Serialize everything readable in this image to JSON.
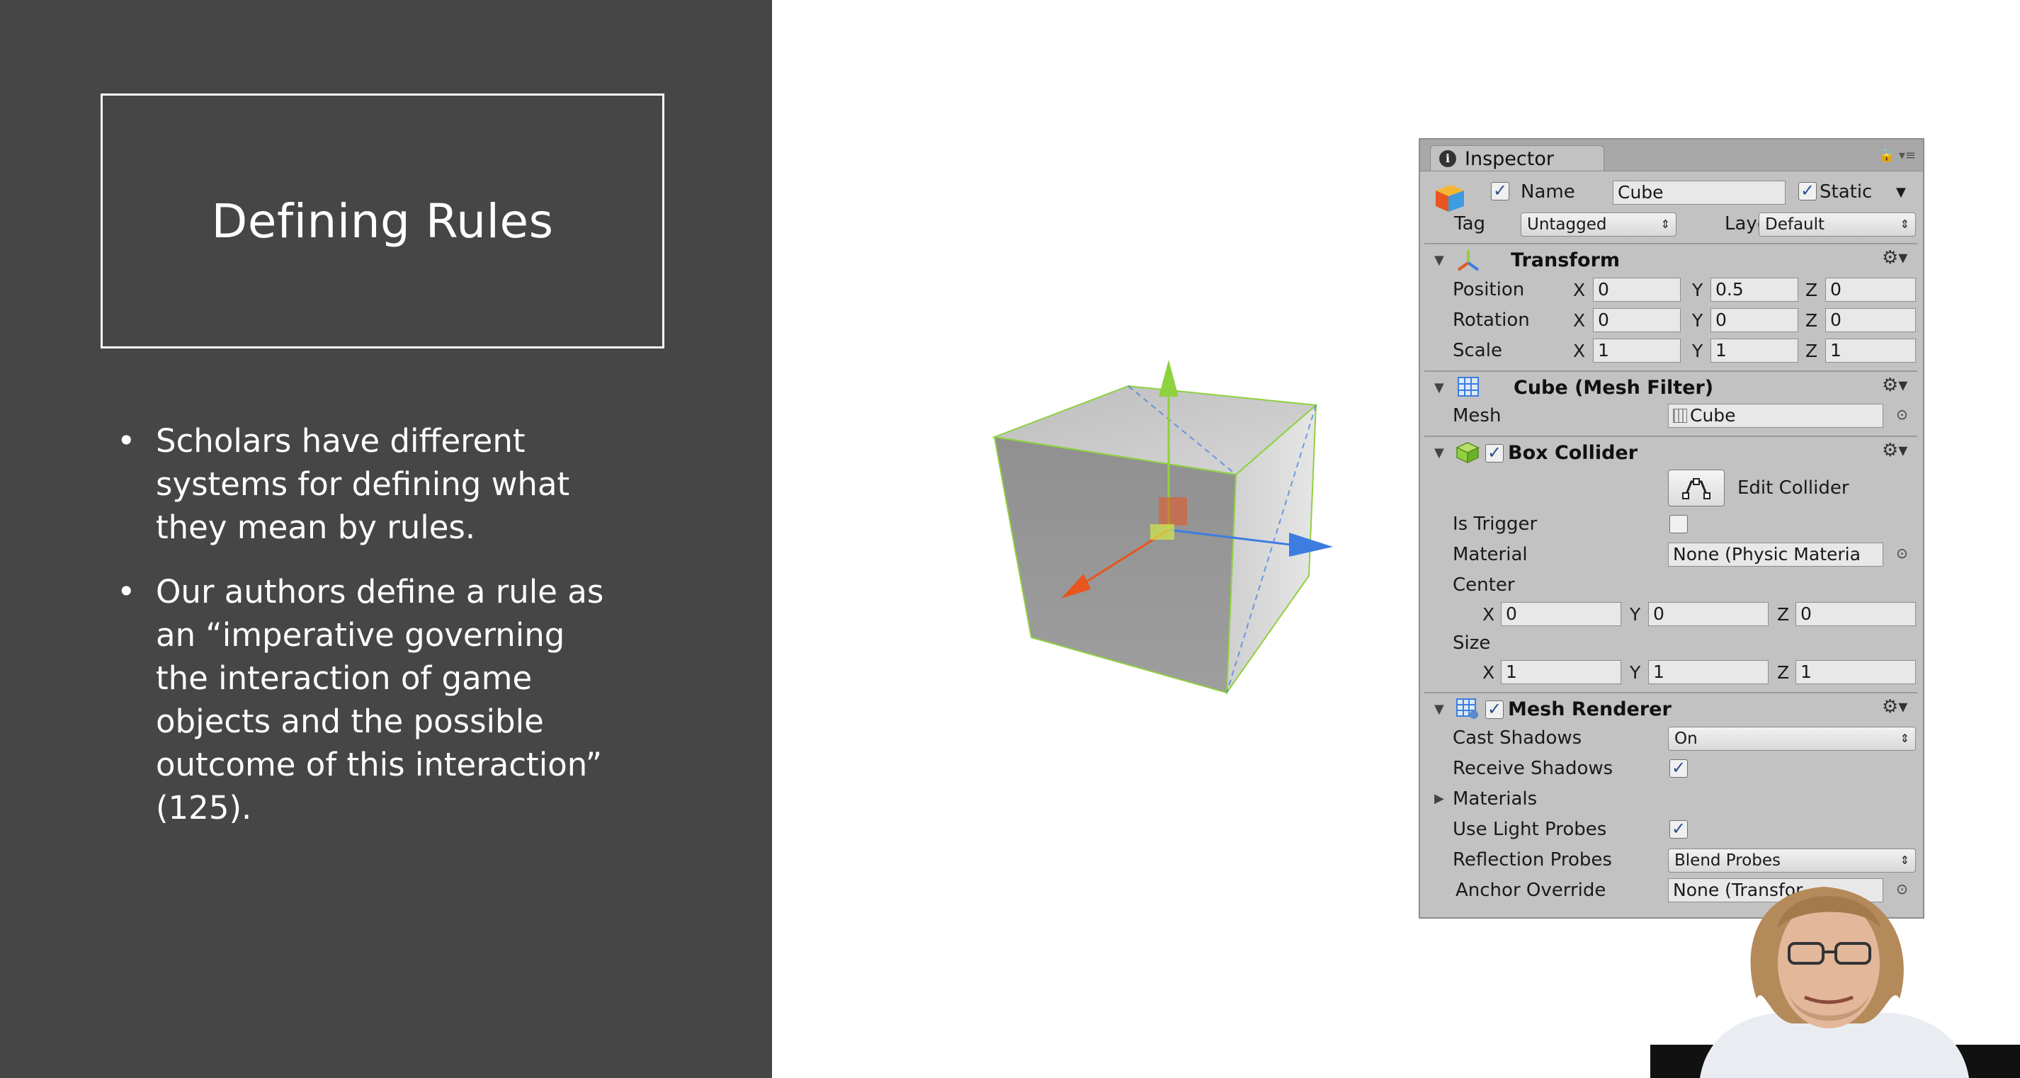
{
  "slide": {
    "title": "Defining Rules",
    "bullets": [
      {
        "line1": "Scholars have different",
        "line2": "systems for defining what",
        "line3": "they mean by rules."
      },
      {
        "line1": "Our authors define a rule as",
        "line2": "an “imperative governing",
        "line3": "the interaction of game",
        "line4": "objects and the possible",
        "line5": "outcome of this interaction”",
        "line6": "(125)."
      }
    ],
    "bullet_symbol": "•"
  },
  "inspector": {
    "tab_label": "Inspector",
    "tab_icons": "🔒 ▾≡",
    "name_label": "Name",
    "name_value": "Cube",
    "name_checked": "✓",
    "static_label": "Static",
    "static_checked": "✓",
    "tag_label": "Tag",
    "tag_value": "Untagged",
    "layer_label": "Layer",
    "layer_value": "Default",
    "transform": {
      "title": "Transform",
      "position_label": "Position",
      "position": {
        "x": "0",
        "y": "0.5",
        "z": "0"
      },
      "rotation_label": "Rotation",
      "rotation": {
        "x": "0",
        "y": "0",
        "z": "0"
      },
      "scale_label": "Scale",
      "scale": {
        "x": "1",
        "y": "1",
        "z": "1"
      }
    },
    "mesh_filter": {
      "title": "Cube (Mesh Filter)",
      "mesh_label": "Mesh",
      "mesh_value": "Cube"
    },
    "box_collider": {
      "title": "Box Collider",
      "enabled": "✓",
      "edit_label": "Edit Collider",
      "is_trigger_label": "Is Trigger",
      "material_label": "Material",
      "material_value": "None (Physic Materia",
      "center_label": "Center",
      "center": {
        "x": "0",
        "y": "0",
        "z": "0"
      },
      "size_label": "Size",
      "size": {
        "x": "1",
        "y": "1",
        "z": "1"
      }
    },
    "mesh_renderer": {
      "title": "Mesh Renderer",
      "enabled": "✓",
      "cast_shadows_label": "Cast Shadows",
      "cast_shadows_value": "On",
      "receive_shadows_label": "Receive Shadows",
      "receive_shadows": "✓",
      "materials_label": "Materials",
      "light_probes_label": "Use Light Probes",
      "light_probes": "✓",
      "reflection_probes_label": "Reflection Probes",
      "reflection_probes_value": "Blend Probes",
      "anchor_override_label": "Anchor Override",
      "anchor_override_value": "None (Transfor"
    },
    "axes": {
      "x": "X",
      "y": "Y",
      "z": "Z"
    },
    "gear": "⚙▾",
    "collapse": "▼",
    "expand": "▶",
    "picker": "⊙",
    "dropdown_arrow": "⇕",
    "dropdown_caret": "▼"
  },
  "colors": {
    "slide_bg": "#464646",
    "inspector_bg": "#c2c2c2",
    "gizmo_y": "#8fd13f",
    "gizmo_x": "#e8551e",
    "gizmo_z": "#3d7de0"
  }
}
